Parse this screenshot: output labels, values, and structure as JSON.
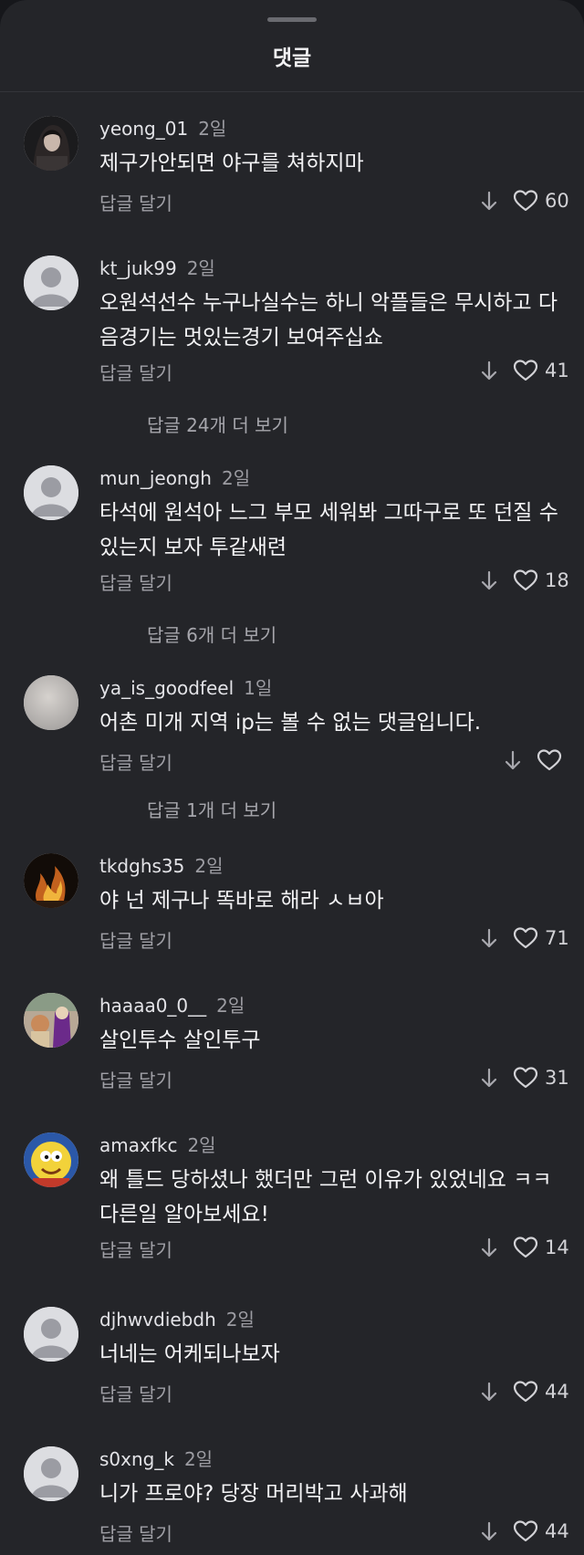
{
  "sheet": {
    "title": "댓글"
  },
  "comments": [
    {
      "username": "yeong_01",
      "time": "2일",
      "text": "제구가안되면 야구를 쳐하지마",
      "reply_label": "답글 달기",
      "likes": "60",
      "avatar": "photo-dark"
    },
    {
      "username": "kt_juk99",
      "time": "2일",
      "text": "오원석선수 누구나실수는 하니 악플들은 무시하고 다음경기는 멋있는경기 보여주십쇼",
      "reply_label": "답글 달기",
      "likes": "41",
      "more_replies": "답글 24개 더 보기",
      "avatar": "default"
    },
    {
      "username": "mun_jeongh",
      "time": "2일",
      "text": "타석에 원석아 느그 부모 세워봐 그따구로 또 던질 수 있는지 보자 투같새련",
      "reply_label": "답글 달기",
      "likes": "18",
      "more_replies": "답글 6개 더 보기",
      "avatar": "default"
    },
    {
      "username": "ya_is_goodfeel",
      "time": "1일",
      "text": "어촌 미개 지역 ip는 볼 수 없는 댓글입니다.",
      "reply_label": "답글 달기",
      "likes": "",
      "more_replies": "답글 1개 더 보기",
      "avatar": "blurred"
    },
    {
      "username": "tkdghs35",
      "time": "2일",
      "text": "야 넌 제구나 똑바로 해라 ㅅㅂ아",
      "reply_label": "답글 달기",
      "likes": "71",
      "avatar": "fire"
    },
    {
      "username": "haaaa0_0__",
      "time": "2일",
      "text": "살인투수 살인투구",
      "reply_label": "답글 달기",
      "likes": "31",
      "avatar": "cartoon-purple"
    },
    {
      "username": "amaxfkc",
      "time": "2일",
      "text": "왜 틀드 당하셨나 했더만 그런 이유가 있었네요 ㅋㅋ 다른일 알아보세요!",
      "reply_label": "답글 달기",
      "likes": "14",
      "avatar": "cartoon-yellow"
    },
    {
      "username": "djhwvdiebdh",
      "time": "2일",
      "text": "너네는 어케되나보자",
      "reply_label": "답글 달기",
      "likes": "44",
      "avatar": "default"
    },
    {
      "username": "s0xng_k",
      "time": "2일",
      "text": "니가 프로야? 당장 머리박고 사과해",
      "reply_label": "답글 달기",
      "likes": "44",
      "avatar": "default"
    }
  ],
  "colors": {
    "background": "#242529",
    "text": "#f3f3f5",
    "muted": "#a0a0a6"
  }
}
